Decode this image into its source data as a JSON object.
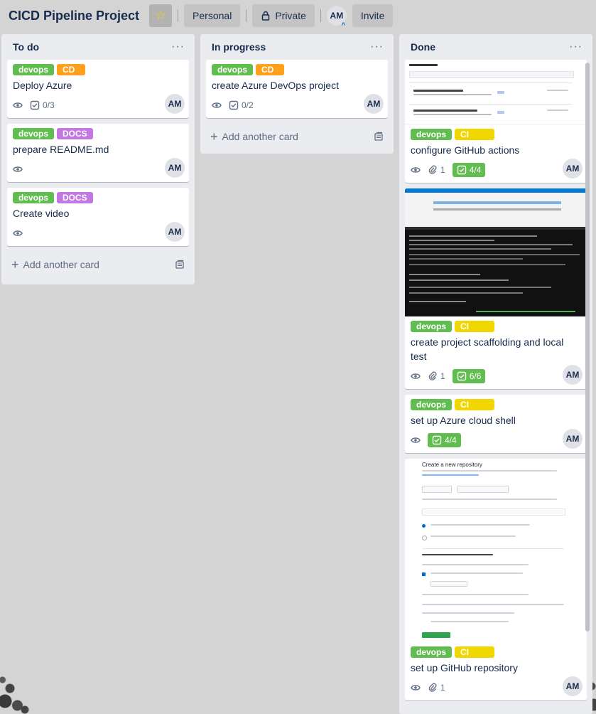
{
  "header": {
    "title": "CICD Pipeline Project",
    "visibility_workspace": "Personal",
    "visibility_private": "Private",
    "member_initials": "AM",
    "invite_label": "Invite"
  },
  "lists": [
    {
      "title": "To do",
      "add_card_label": "Add another card",
      "cards": [
        {
          "labels": [
            "devops",
            "CD"
          ],
          "title": "Deploy Azure",
          "checklist": "0/3",
          "avatar": "AM"
        },
        {
          "labels": [
            "devops",
            "DOCS"
          ],
          "title": "prepare README.md",
          "avatar": "AM"
        },
        {
          "labels": [
            "devops",
            "DOCS"
          ],
          "title": "Create video",
          "avatar": "AM"
        }
      ]
    },
    {
      "title": "In progress",
      "add_card_label": "Add another card",
      "cards": [
        {
          "labels": [
            "devops",
            "CD"
          ],
          "title": "create Azure DevOps project",
          "checklist": "0/2",
          "avatar": "AM"
        }
      ]
    },
    {
      "title": "Done",
      "cards": [
        {
          "labels": [
            "devops",
            "CI"
          ],
          "title": "configure GitHub actions",
          "attachments": "1",
          "checklist": "4/4",
          "avatar": "AM"
        },
        {
          "labels": [
            "devops",
            "CI"
          ],
          "title": "create project scaffolding and local test",
          "attachments": "1",
          "checklist": "6/6",
          "avatar": "AM"
        },
        {
          "labels": [
            "devops",
            "CI"
          ],
          "title": "set up Azure cloud shell",
          "checklist": "4/4",
          "avatar": "AM"
        },
        {
          "labels": [
            "devops",
            "CI"
          ],
          "title": "set up GitHub repository",
          "attachments": "1",
          "avatar": "AM",
          "thumb_heading": "Create a new repository"
        }
      ]
    }
  ],
  "colors": {
    "green": "#61bd4f",
    "orange": "#ff9f1a",
    "purple": "#c377e0",
    "yellow": "#f2d600"
  }
}
